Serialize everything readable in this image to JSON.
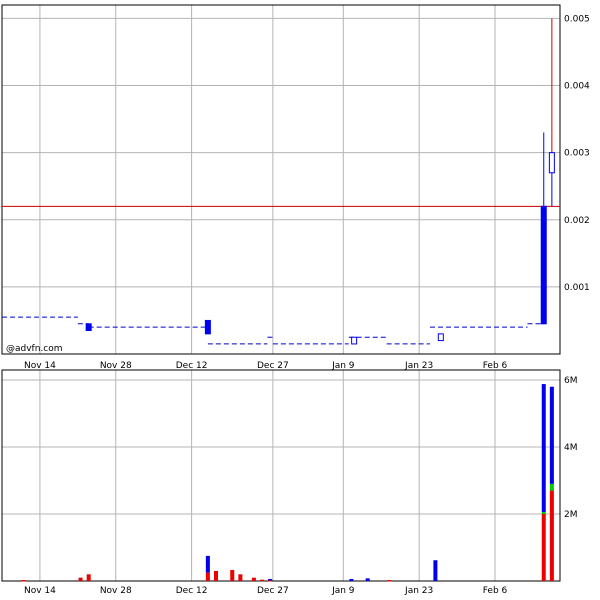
{
  "watermark": "@advfn.com",
  "colors": {
    "grid": "#b4b4b4",
    "frame": "#000000",
    "price_line": "#0000cc",
    "candle_blue": "#0000ee",
    "reference_line": "#cc0000",
    "volume_red": "#ee0000",
    "volume_blue": "#0000ee",
    "volume_green": "#00cc00"
  },
  "chart_data": [
    {
      "type": "candlestick",
      "x_tick_labels": [
        "Nov 14",
        "Nov 28",
        "Dec 12",
        "Dec 27",
        "Jan 9",
        "Jan 23",
        "Feb 6"
      ],
      "y_tick_labels": [
        "0.001",
        "0.002",
        "0.003",
        "0.004",
        "0.005"
      ],
      "y_ticks": [
        0.001,
        0.002,
        0.003,
        0.004,
        0.005
      ],
      "ylim": [
        0,
        0.0052
      ],
      "x_range_days": [
        0,
        103
      ],
      "x_tick_days": [
        7,
        21,
        35,
        50,
        63,
        77,
        91
      ],
      "reference_line": 0.0022,
      "price_segments": [
        {
          "x0": 0,
          "x1": 14,
          "y": 0.00055
        },
        {
          "x0": 14,
          "x1": 16,
          "y": 0.00045
        },
        {
          "x0": 16,
          "x1": 38,
          "y": 0.0004
        },
        {
          "x0": 38,
          "x1": 49,
          "y": 0.00015
        },
        {
          "x0": 49,
          "x1": 50,
          "y": 0.00025
        },
        {
          "x0": 50,
          "x1": 64,
          "y": 0.00015
        },
        {
          "x0": 64,
          "x1": 71,
          "y": 0.00025
        },
        {
          "x0": 71,
          "x1": 79,
          "y": 0.00015
        },
        {
          "x0": 79,
          "x1": 97,
          "y": 0.0004
        },
        {
          "x0": 97,
          "x1": 100,
          "y": 0.00045
        }
      ],
      "candles": [
        {
          "x": 16,
          "open": 0.00045,
          "close": 0.00035,
          "high": 0.00045,
          "low": 0.00035
        },
        {
          "x": 38,
          "open": 0.0005,
          "close": 0.0003,
          "high": 0.0005,
          "low": 0.0003
        },
        {
          "x": 65,
          "open": 0.00015,
          "close": 0.00025,
          "high": 0.00025,
          "low": 0.00015
        },
        {
          "x": 81,
          "open": 0.0002,
          "close": 0.0003,
          "high": 0.0003,
          "low": 0.0002
        },
        {
          "x": 100,
          "open": 0.0022,
          "close": 0.00045,
          "high": 0.0033,
          "low": 0.00045
        },
        {
          "x": 101.5,
          "open": 0.0027,
          "close": 0.003,
          "high": 0.005,
          "low": 0.0022
        }
      ]
    },
    {
      "type": "bar",
      "x_tick_labels": [
        "Nov 14",
        "Nov 28",
        "Dec 12",
        "Dec 27",
        "Jan 9",
        "Jan 23",
        "Feb 6"
      ],
      "y_tick_labels": [
        "2M",
        "4M",
        "6M"
      ],
      "y_ticks": [
        2000000,
        4000000,
        6000000
      ],
      "ylim": [
        0,
        6300000
      ],
      "x_range_days": [
        0,
        103
      ],
      "x_tick_days": [
        7,
        21,
        35,
        50,
        63,
        77,
        91
      ],
      "bars": [
        {
          "x": 4,
          "segments": [
            {
              "color": "red",
              "value": 30000
            }
          ]
        },
        {
          "x": 14.5,
          "segments": [
            {
              "color": "red",
              "value": 100000
            }
          ]
        },
        {
          "x": 16,
          "segments": [
            {
              "color": "red",
              "value": 200000
            }
          ]
        },
        {
          "x": 38,
          "segments": [
            {
              "color": "red",
              "value": 250000
            },
            {
              "color": "blue",
              "value": 500000
            }
          ]
        },
        {
          "x": 39.5,
          "segments": [
            {
              "color": "red",
              "value": 300000
            }
          ]
        },
        {
          "x": 42.5,
          "segments": [
            {
              "color": "red",
              "value": 330000
            }
          ]
        },
        {
          "x": 44,
          "segments": [
            {
              "color": "red",
              "value": 200000
            }
          ]
        },
        {
          "x": 46.5,
          "segments": [
            {
              "color": "red",
              "value": 100000
            }
          ]
        },
        {
          "x": 48,
          "segments": [
            {
              "color": "red",
              "value": 40000
            }
          ]
        },
        {
          "x": 49.5,
          "segments": [
            {
              "color": "red",
              "value": 30000
            },
            {
              "color": "blue",
              "value": 30000
            }
          ]
        },
        {
          "x": 64.5,
          "segments": [
            {
              "color": "blue",
              "value": 60000
            }
          ]
        },
        {
          "x": 67.5,
          "segments": [
            {
              "color": "blue",
              "value": 80000
            }
          ]
        },
        {
          "x": 71.5,
          "segments": [
            {
              "color": "red",
              "value": 30000
            }
          ]
        },
        {
          "x": 80,
          "segments": [
            {
              "color": "blue",
              "value": 620000
            }
          ]
        },
        {
          "x": 100,
          "segments": [
            {
              "color": "red",
              "value": 2000000
            },
            {
              "color": "green",
              "value": 60000
            },
            {
              "color": "blue",
              "value": 3820000
            }
          ]
        },
        {
          "x": 101.5,
          "segments": [
            {
              "color": "red",
              "value": 2700000
            },
            {
              "color": "green",
              "value": 200000
            },
            {
              "color": "blue",
              "value": 2900000
            }
          ]
        }
      ]
    }
  ]
}
